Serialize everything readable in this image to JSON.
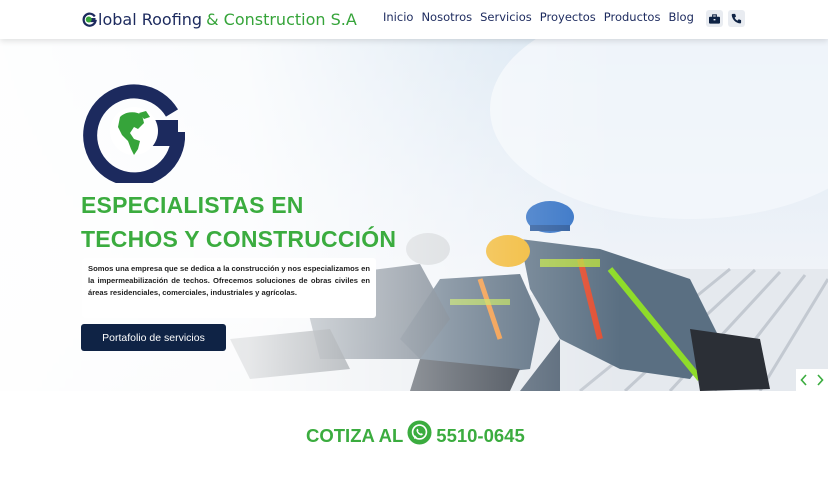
{
  "navbar": {
    "brand_part1": "lobal Roofing",
    "brand_part2": "& Construction S.A",
    "links": [
      "Inicio",
      "Nosotros",
      "Servicios",
      "Proyectos",
      "Productos",
      "Blog"
    ],
    "icons": [
      "briefcase-icon",
      "phone-icon"
    ]
  },
  "hero": {
    "title_line1": "ESPECIALISTAS EN",
    "title_line2": "TECHOS Y CONSTRUCCIÓN",
    "description": "Somos una empresa que se dedica a la construcción y nos especializamos en la impermeabilización de techos. Ofrecemos soluciones de obras civiles en áreas residenciales, comerciales, industriales y agrícolas.",
    "button_label": "Portafolio de servicios"
  },
  "cotiza": {
    "label": "COTIZA AL",
    "phone": "5510-0645"
  },
  "colors": {
    "brand_green": "#3bac3f",
    "brand_navy": "#1c2a5e",
    "button_navy": "#0f2345"
  }
}
